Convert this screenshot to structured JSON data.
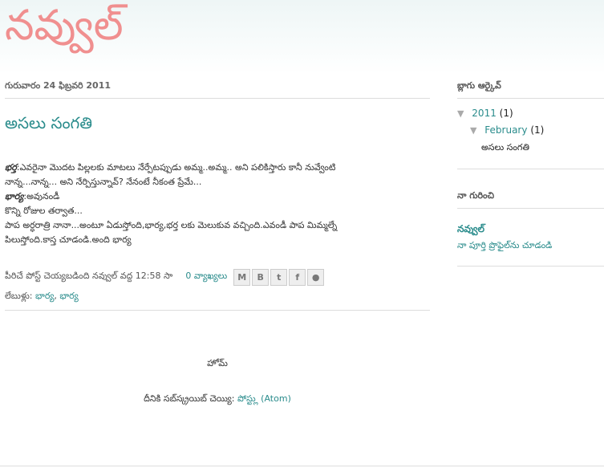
{
  "blog": {
    "title": "నవ్వుల్"
  },
  "post": {
    "date": "గురువారం 24 ఫిబ్రవరి 2011",
    "title": "అసలు సంగతి",
    "body": [
      {
        "bold": "భర్త",
        "text": ":ఎవరైనా మొదట పిల్లలకు మాటలు నేర్పేటప్పుడు అమ్మ..అమ్మ.. అని పలికిస్తారు కానీ నువ్వేంటి"
      },
      {
        "bold": "",
        "text": "నాన్న...నాన్న... అని నేర్పిస్తున్నావ్? నేనంటే నీకంత ప్రేమే..."
      },
      {
        "bold": "భార్య",
        "text": ":అవునండీ"
      },
      {
        "bold": "",
        "text": "కొన్ని రోజుల తర్వాత..."
      },
      {
        "bold": "",
        "text": "పాప అర్ధరాత్రి నానా...అంటూ ఏడుస్తోంది,భార్య,భర్త లకు మెలుకువ వచ్చింది.ఎవండీ పాప మిమ్మల్నే"
      },
      {
        "bold": "",
        "text": "పిలుస్తోంది.కాస్త చూడండి.అంది భార్య"
      }
    ],
    "footer": {
      "posted_by": "పీరిచే పోస్ట్ చెయ్యబడింది నవ్వుల్ వద్ద 12:58 సా",
      "comments": "0 వ్యాఖ్యలు",
      "share_buttons": [
        "email-icon",
        "blogger-icon",
        "twitter-icon",
        "facebook-icon",
        "buzz-icon"
      ],
      "labels_prefix": "లేబుళ్లు:",
      "labels": [
        "భార్య",
        "భార్య"
      ]
    }
  },
  "nav": {
    "home": "హోమ్"
  },
  "subscribe": {
    "prefix": "దీనికి సబ్‌స్క్రయిబ్ చెయ్యి:",
    "link": "పోస్ట్లు (Atom)"
  },
  "sidebar": {
    "archive_title": "బ్లాగు ఆర్కైవ్",
    "archive": {
      "year": "2011",
      "year_count": "(1)",
      "month": "February",
      "month_count": "(1)",
      "post": "అసలు సంగతి"
    },
    "about_title": "నా గురించి",
    "about_name": "నవ్వుల్",
    "about_profile": "నా పూర్తి ప్రొఫైల్‌ను చూడండి"
  }
}
